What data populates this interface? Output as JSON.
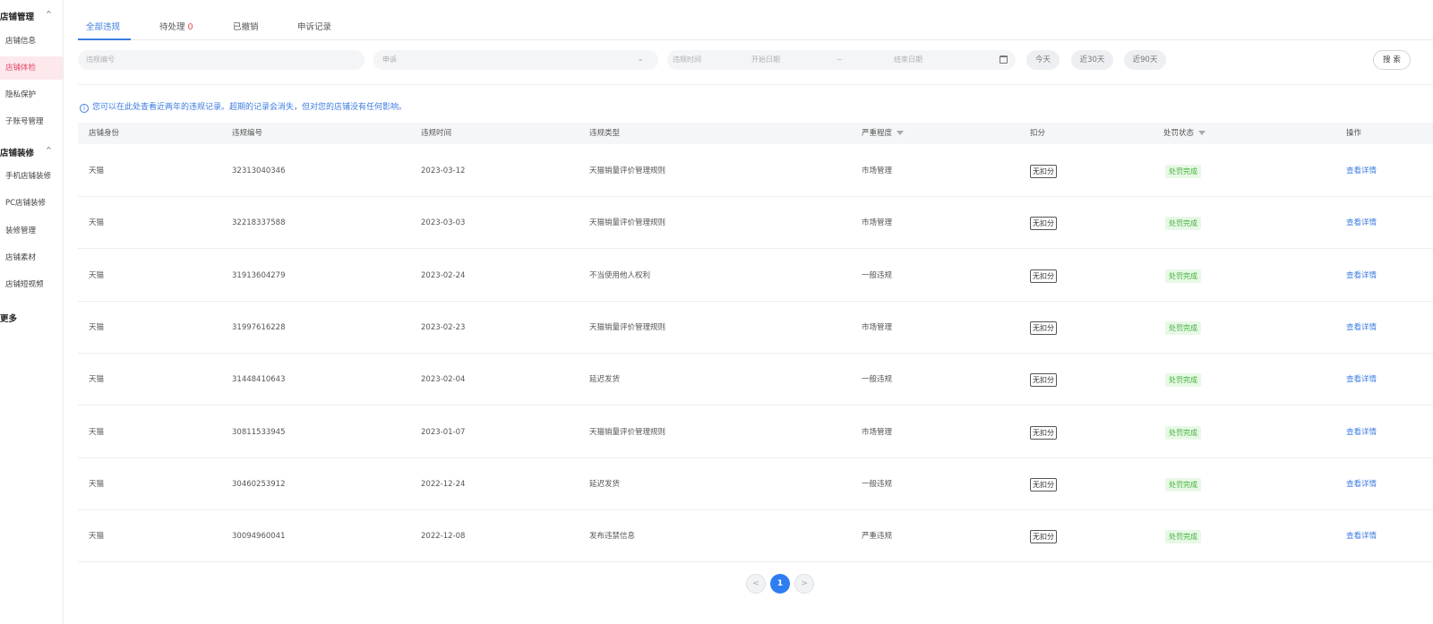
{
  "sidebar": {
    "groups": [
      {
        "label": "店铺管理",
        "chevron": "^"
      },
      {
        "label": "店铺装修",
        "chevron": "^"
      },
      {
        "label": "更多"
      }
    ],
    "items": [
      {
        "label": "店铺信息"
      },
      {
        "label": "店铺体检",
        "active": true
      },
      {
        "label": "隐私保护"
      },
      {
        "label": "子账号管理"
      },
      {
        "label": "手机店铺装修"
      },
      {
        "label": "PC店铺装修"
      },
      {
        "label": "装修管理"
      },
      {
        "label": "店铺素材"
      },
      {
        "label": "店铺短视频"
      }
    ]
  },
  "tabs": [
    {
      "label": "全部违规",
      "active": true
    },
    {
      "label": "待处理",
      "count": "0"
    },
    {
      "label": "已撤销"
    },
    {
      "label": "申诉记录"
    }
  ],
  "filters": {
    "violation_no_placeholder": "违规编号",
    "appeal_select": "申诉",
    "time_label": "违规时间",
    "start_date_placeholder": "开始日期",
    "date_separator": "~",
    "end_date_placeholder": "结束日期",
    "quick_ranges": [
      "今天",
      "近30天",
      "近90天"
    ],
    "search_label": "搜 索"
  },
  "notice": {
    "icon": "info-circle-icon",
    "text": "您可以在此处查看近两年的违规记录。超期的记录会消失，但对您的店铺没有任何影响。"
  },
  "table": {
    "columns": [
      "店铺身份",
      "违规编号",
      "违规时间",
      "违规类型",
      "严重程度",
      "扣分",
      "处罚状态",
      "操作"
    ],
    "rows": [
      {
        "identity": "天猫",
        "number": "32313040346",
        "time": "2023-03-12",
        "type": "天猫销量评价管理规则",
        "severity": "市场管理",
        "deduction": "无扣分",
        "status": "处罚完成",
        "action": "查看详情"
      },
      {
        "identity": "天猫",
        "number": "32218337588",
        "time": "2023-03-03",
        "type": "天猫销量评价管理规则",
        "severity": "市场管理",
        "deduction": "无扣分",
        "status": "处罚完成",
        "action": "查看详情"
      },
      {
        "identity": "天猫",
        "number": "31913604279",
        "time": "2023-02-24",
        "type": "不当使用他人权利",
        "severity": "一般违规",
        "deduction": "无扣分",
        "status": "处罚完成",
        "action": "查看详情"
      },
      {
        "identity": "天猫",
        "number": "31997616228",
        "time": "2023-02-23",
        "type": "天猫销量评价管理规则",
        "severity": "市场管理",
        "deduction": "无扣分",
        "status": "处罚完成",
        "action": "查看详情"
      },
      {
        "identity": "天猫",
        "number": "31448410643",
        "time": "2023-02-04",
        "type": "延迟发货",
        "severity": "一般违规",
        "deduction": "无扣分",
        "status": "处罚完成",
        "action": "查看详情"
      },
      {
        "identity": "天猫",
        "number": "30811533945",
        "time": "2023-01-07",
        "type": "天猫销量评价管理规则",
        "severity": "市场管理",
        "deduction": "无扣分",
        "status": "处罚完成",
        "action": "查看详情"
      },
      {
        "identity": "天猫",
        "number": "30460253912",
        "time": "2022-12-24",
        "type": "延迟发货",
        "severity": "一般违规",
        "deduction": "无扣分",
        "status": "处罚完成",
        "action": "查看详情"
      },
      {
        "identity": "天猫",
        "number": "30094960041",
        "time": "2022-12-08",
        "type": "发布违禁信息",
        "severity": "严重违规",
        "deduction": "无扣分",
        "status": "处罚完成",
        "action": "查看详情"
      }
    ]
  },
  "pagination": {
    "prev": "<",
    "current": "1",
    "next": ">"
  },
  "colors": {
    "accent": "#3e7de0",
    "sidebar_active": "#e24a68",
    "status_green": "#3fb13a"
  }
}
